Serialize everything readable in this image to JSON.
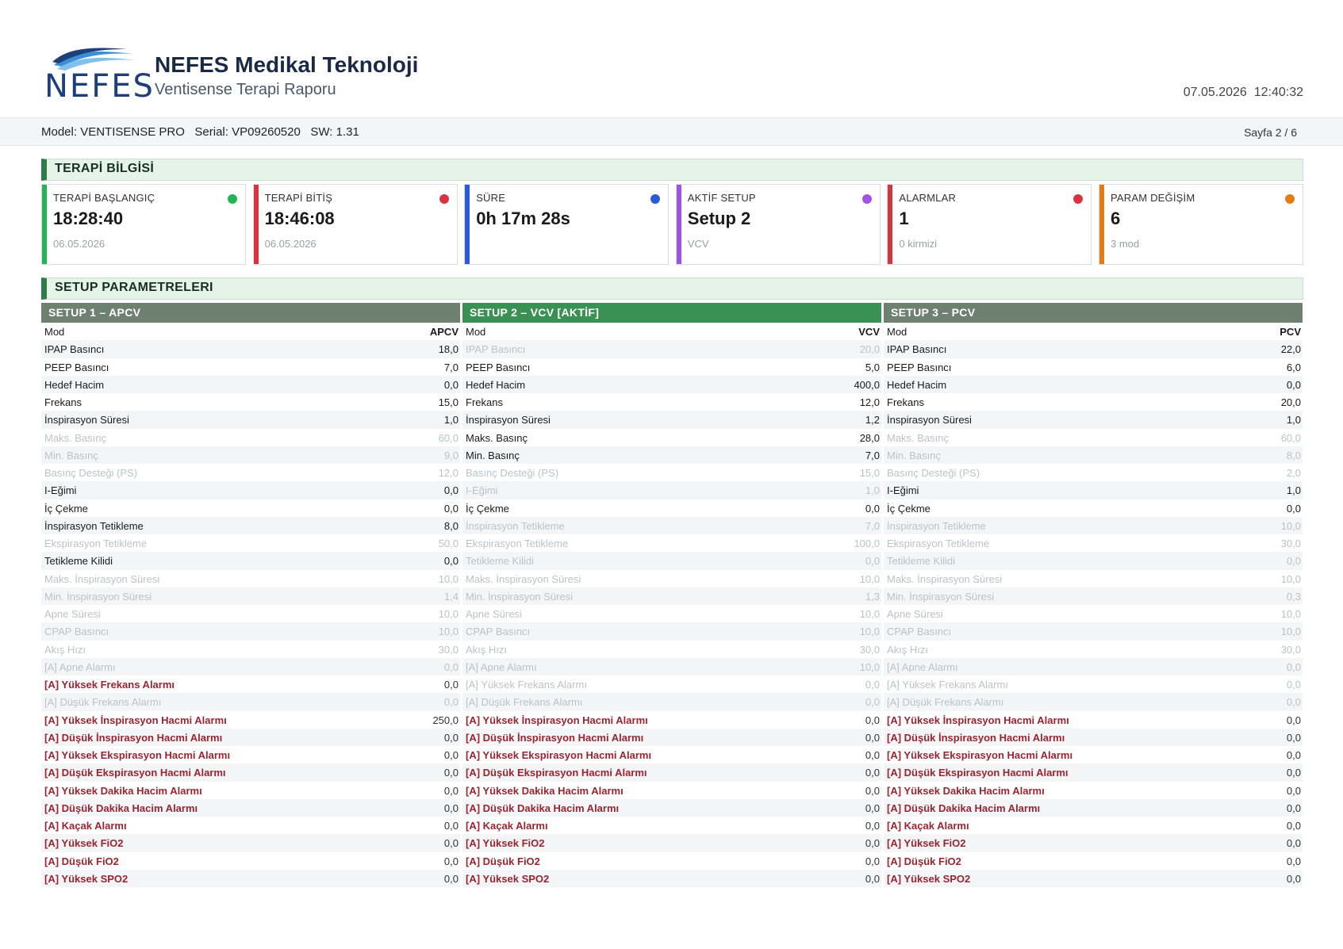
{
  "header": {
    "logo_text": "NEFES",
    "company": "NEFES Medikal Teknoloji",
    "report_title": "Ventisense Terapi Raporu",
    "date": "07.05.2026",
    "time": "12:40:32",
    "brand_color": "#1e3f7a"
  },
  "infobar": {
    "model": "Model: VENTISENSE PRO",
    "serial": "Serial: VP09260520",
    "sw": "SW: 1.31",
    "page": "Sayfa 2 / 6"
  },
  "sections": {
    "therapy": "TERAPİ BİLGİSİ",
    "setup": "SETUP PARAMETRELERI"
  },
  "cards": [
    {
      "label": "TERAPİ BAŞLANGIÇ",
      "value": "18:28:40",
      "sub": "06.05.2026",
      "color": "#22b455"
    },
    {
      "label": "TERAPİ BİTİŞ",
      "value": "18:46:08",
      "sub": "06.05.2026",
      "color": "#d9333f"
    },
    {
      "label": "SÜRE",
      "value": "0h 17m 28s",
      "sub": "",
      "color": "#2a5bd7"
    },
    {
      "label": "AKTİF SETUP",
      "value": "Setup 2",
      "sub": "VCV",
      "color": "#a052e0"
    },
    {
      "label": "ALARMLAR",
      "value": "1",
      "sub": "0 kirmizi",
      "color": "#d9333f"
    },
    {
      "label": "PARAM DEĞİŞİM",
      "value": "6",
      "sub": "3 mod",
      "color": "#e07e16"
    }
  ],
  "setups": [
    {
      "title": "SETUP 1  –  APCV",
      "header_color": "#6e8070",
      "params": [
        {
          "name": "Mod",
          "value": "APCV",
          "state": "mode"
        },
        {
          "name": "IPAP Basıncı",
          "value": "18,0",
          "state": "active"
        },
        {
          "name": "PEEP Basıncı",
          "value": "7,0",
          "state": "active"
        },
        {
          "name": "Hedef Hacim",
          "value": "0,0",
          "state": "active"
        },
        {
          "name": "Frekans",
          "value": "15,0",
          "state": "active"
        },
        {
          "name": "İnspirasyon Süresi",
          "value": "1,0",
          "state": "active"
        },
        {
          "name": "Maks. Basınç",
          "value": "60,0",
          "state": "inactive"
        },
        {
          "name": "Min. Basınç",
          "value": "9,0",
          "state": "inactive"
        },
        {
          "name": "Basınç Desteği (PS)",
          "value": "12,0",
          "state": "inactive"
        },
        {
          "name": "I-Eğimi",
          "value": "0,0",
          "state": "active"
        },
        {
          "name": "İç Çekme",
          "value": "0,0",
          "state": "active"
        },
        {
          "name": "İnspirasyon Tetikleme",
          "value": "8,0",
          "state": "active"
        },
        {
          "name": "Ekspirasyon Tetikleme",
          "value": "50,0",
          "state": "inactive"
        },
        {
          "name": "Tetikleme Kilidi",
          "value": "0,0",
          "state": "active"
        },
        {
          "name": "Maks. İnspirasyon Süresi",
          "value": "10,0",
          "state": "inactive"
        },
        {
          "name": "Min. İnspirasyon Süresi",
          "value": "1,4",
          "state": "inactive"
        },
        {
          "name": "Apne Süresi",
          "value": "10,0",
          "state": "inactive"
        },
        {
          "name": "CPAP Basıncı",
          "value": "10,0",
          "state": "inactive"
        },
        {
          "name": "Akış Hızı",
          "value": "30,0",
          "state": "inactive"
        },
        {
          "name": "[A] Apne Alarmı",
          "value": "0,0",
          "state": "inactive"
        },
        {
          "name": "[A] Yüksek Frekans Alarmı",
          "value": "0,0",
          "state": "alarm"
        },
        {
          "name": "[A] Düşük Frekans Alarmı",
          "value": "0,0",
          "state": "inactive"
        },
        {
          "name": "[A] Yüksek İnspirasyon Hacmi Alarmı",
          "value": "250,0",
          "state": "alarm"
        },
        {
          "name": "[A] Düşük İnspirasyon Hacmi Alarmı",
          "value": "0,0",
          "state": "alarm"
        },
        {
          "name": "[A] Yüksek Ekspirasyon Hacmi Alarmı",
          "value": "0,0",
          "state": "alarm"
        },
        {
          "name": "[A] Düşük Ekspirasyon Hacmi Alarmı",
          "value": "0,0",
          "state": "alarm"
        },
        {
          "name": "[A] Yüksek Dakika Hacim Alarmı",
          "value": "0,0",
          "state": "alarm"
        },
        {
          "name": "[A] Düşük Dakika Hacim Alarmı",
          "value": "0,0",
          "state": "alarm"
        },
        {
          "name": "[A] Kaçak Alarmı",
          "value": "0,0",
          "state": "alarm"
        },
        {
          "name": "[A] Yüksek FiO2",
          "value": "0,0",
          "state": "alarm"
        },
        {
          "name": "[A] Düşük FiO2",
          "value": "0,0",
          "state": "alarm"
        },
        {
          "name": "[A] Yüksek SPO2",
          "value": "0,0",
          "state": "alarm"
        }
      ]
    },
    {
      "title": "SETUP 2  –  VCV [AKTİF]",
      "header_color": "#3a9154",
      "params": [
        {
          "name": "Mod",
          "value": "VCV",
          "state": "mode"
        },
        {
          "name": "IPAP Basıncı",
          "value": "20,0",
          "state": "inactive"
        },
        {
          "name": "PEEP Basıncı",
          "value": "5,0",
          "state": "active"
        },
        {
          "name": "Hedef Hacim",
          "value": "400,0",
          "state": "active"
        },
        {
          "name": "Frekans",
          "value": "12,0",
          "state": "active"
        },
        {
          "name": "İnspirasyon Süresi",
          "value": "1,2",
          "state": "active"
        },
        {
          "name": "Maks. Basınç",
          "value": "28,0",
          "state": "active"
        },
        {
          "name": "Min. Basınç",
          "value": "7,0",
          "state": "active"
        },
        {
          "name": "Basınç Desteği (PS)",
          "value": "15,0",
          "state": "inactive"
        },
        {
          "name": "I-Eğimi",
          "value": "1,0",
          "state": "inactive"
        },
        {
          "name": "İç Çekme",
          "value": "0,0",
          "state": "active"
        },
        {
          "name": "İnspirasyon Tetikleme",
          "value": "7,0",
          "state": "inactive"
        },
        {
          "name": "Ekspirasyon Tetikleme",
          "value": "100,0",
          "state": "inactive"
        },
        {
          "name": "Tetikleme Kilidi",
          "value": "0,0",
          "state": "inactive"
        },
        {
          "name": "Maks. İnspirasyon Süresi",
          "value": "10,0",
          "state": "inactive"
        },
        {
          "name": "Min. İnspirasyon Süresi",
          "value": "1,3",
          "state": "inactive"
        },
        {
          "name": "Apne Süresi",
          "value": "10,0",
          "state": "inactive"
        },
        {
          "name": "CPAP Basıncı",
          "value": "10,0",
          "state": "inactive"
        },
        {
          "name": "Akış Hızı",
          "value": "30,0",
          "state": "inactive"
        },
        {
          "name": "[A] Apne Alarmı",
          "value": "10,0",
          "state": "inactive"
        },
        {
          "name": "[A] Yüksek Frekans Alarmı",
          "value": "0,0",
          "state": "inactive"
        },
        {
          "name": "[A] Düşük Frekans Alarmı",
          "value": "0,0",
          "state": "inactive"
        },
        {
          "name": "[A] Yüksek İnspirasyon Hacmi Alarmı",
          "value": "0,0",
          "state": "alarm"
        },
        {
          "name": "[A] Düşük İnspirasyon Hacmi Alarmı",
          "value": "0,0",
          "state": "alarm"
        },
        {
          "name": "[A] Yüksek Ekspirasyon Hacmi Alarmı",
          "value": "0,0",
          "state": "alarm"
        },
        {
          "name": "[A] Düşük Ekspirasyon Hacmi Alarmı",
          "value": "0,0",
          "state": "alarm"
        },
        {
          "name": "[A] Yüksek Dakika Hacim Alarmı",
          "value": "0,0",
          "state": "alarm"
        },
        {
          "name": "[A] Düşük Dakika Hacim Alarmı",
          "value": "0,0",
          "state": "alarm"
        },
        {
          "name": "[A] Kaçak Alarmı",
          "value": "0,0",
          "state": "alarm"
        },
        {
          "name": "[A] Yüksek FiO2",
          "value": "0,0",
          "state": "alarm"
        },
        {
          "name": "[A] Düşük FiO2",
          "value": "0,0",
          "state": "alarm"
        },
        {
          "name": "[A] Yüksek SPO2",
          "value": "0,0",
          "state": "alarm"
        }
      ]
    },
    {
      "title": "SETUP 3  –  PCV",
      "header_color": "#6e8070",
      "params": [
        {
          "name": "Mod",
          "value": "PCV",
          "state": "mode"
        },
        {
          "name": "IPAP Basıncı",
          "value": "22,0",
          "state": "active"
        },
        {
          "name": "PEEP Basıncı",
          "value": "6,0",
          "state": "active"
        },
        {
          "name": "Hedef Hacim",
          "value": "0,0",
          "state": "active"
        },
        {
          "name": "Frekans",
          "value": "20,0",
          "state": "active"
        },
        {
          "name": "İnspirasyon Süresi",
          "value": "1,0",
          "state": "active"
        },
        {
          "name": "Maks. Basınç",
          "value": "60,0",
          "state": "inactive"
        },
        {
          "name": "Min. Basınç",
          "value": "8,0",
          "state": "inactive"
        },
        {
          "name": "Basınç Desteği (PS)",
          "value": "2,0",
          "state": "inactive"
        },
        {
          "name": "I-Eğimi",
          "value": "1,0",
          "state": "active"
        },
        {
          "name": "İç Çekme",
          "value": "0,0",
          "state": "active"
        },
        {
          "name": "İnspirasyon Tetikleme",
          "value": "10,0",
          "state": "inactive"
        },
        {
          "name": "Ekspirasyon Tetikleme",
          "value": "30,0",
          "state": "inactive"
        },
        {
          "name": "Tetikleme Kilidi",
          "value": "0,0",
          "state": "inactive"
        },
        {
          "name": "Maks. İnspirasyon Süresi",
          "value": "10,0",
          "state": "inactive"
        },
        {
          "name": "Min. İnspirasyon Süresi",
          "value": "0,3",
          "state": "inactive"
        },
        {
          "name": "Apne Süresi",
          "value": "10,0",
          "state": "inactive"
        },
        {
          "name": "CPAP Basıncı",
          "value": "10,0",
          "state": "inactive"
        },
        {
          "name": "Akış Hızı",
          "value": "30,0",
          "state": "inactive"
        },
        {
          "name": "[A] Apne Alarmı",
          "value": "0,0",
          "state": "inactive"
        },
        {
          "name": "[A] Yüksek Frekans Alarmı",
          "value": "0,0",
          "state": "inactive"
        },
        {
          "name": "[A] Düşük Frekans Alarmı",
          "value": "0,0",
          "state": "inactive"
        },
        {
          "name": "[A] Yüksek İnspirasyon Hacmi Alarmı",
          "value": "0,0",
          "state": "alarm"
        },
        {
          "name": "[A] Düşük İnspirasyon Hacmi Alarmı",
          "value": "0,0",
          "state": "alarm"
        },
        {
          "name": "[A] Yüksek Ekspirasyon Hacmi Alarmı",
          "value": "0,0",
          "state": "alarm"
        },
        {
          "name": "[A] Düşük Ekspirasyon Hacmi Alarmı",
          "value": "0,0",
          "state": "alarm"
        },
        {
          "name": "[A] Yüksek Dakika Hacim Alarmı",
          "value": "0,0",
          "state": "alarm"
        },
        {
          "name": "[A] Düşük Dakika Hacim Alarmı",
          "value": "0,0",
          "state": "alarm"
        },
        {
          "name": "[A] Kaçak Alarmı",
          "value": "0,0",
          "state": "alarm"
        },
        {
          "name": "[A] Yüksek FiO2",
          "value": "0,0",
          "state": "alarm"
        },
        {
          "name": "[A] Düşük FiO2",
          "value": "0,0",
          "state": "alarm"
        },
        {
          "name": "[A] Yüksek SPO2",
          "value": "0,0",
          "state": "alarm"
        }
      ]
    }
  ]
}
